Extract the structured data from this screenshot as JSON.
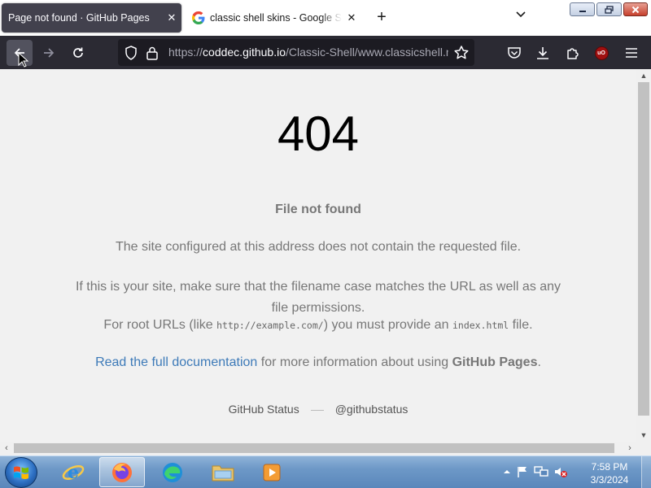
{
  "browser": {
    "tabs": [
      {
        "title": "Page not found · GitHub Pages",
        "active": true
      },
      {
        "title": "classic shell skins - Google Search",
        "active": false
      }
    ],
    "new_tab_symbol": "+",
    "close_symbol": "✕",
    "url": {
      "scheme": "https://",
      "host": "coddec.github.io",
      "path": "/Classic-Shell/www.classicshell.net/"
    },
    "ublock_badge": "uO",
    "accent_color": "#2b2a33"
  },
  "page": {
    "code": "404",
    "heading": "File not found",
    "description": "The site configured at this address does not contain the requested file.",
    "help_text": "If this is your site, make sure that the filename case matches the URL as well as any file permissions.",
    "root_prefix": "For root URLs (like ",
    "root_code_example": "http://example.com/",
    "root_middle": ") you must provide an ",
    "root_code_file": "index.html",
    "root_suffix": " file.",
    "doc_link_text": "Read the full documentation",
    "doc_middle": " for more information about using ",
    "doc_brand": "GitHub Pages",
    "doc_end": ".",
    "footer": {
      "status_link": "GitHub Status",
      "twitter_link": "@githubstatus"
    },
    "link_color": "#3d7ab8"
  },
  "taskbar": {
    "apps": [
      "internet-explorer",
      "firefox",
      "edge",
      "file-explorer",
      "media-player"
    ],
    "clock_time": "7:58 PM",
    "clock_date": "3/3/2024",
    "tray_icons": [
      "show-hidden-icon",
      "action-center-flag-icon",
      "network-icon",
      "volume-muted-icon"
    ]
  }
}
